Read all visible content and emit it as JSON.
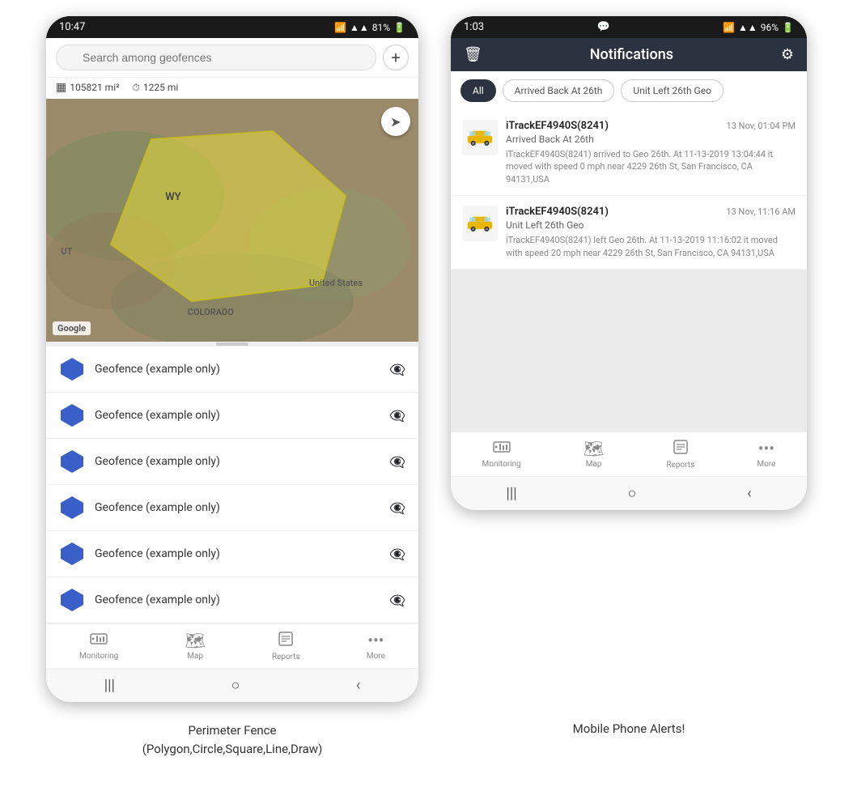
{
  "left_phone": {
    "status_bar": {
      "time": "10:47",
      "signal": "WiFi",
      "bars": "▲▲▲",
      "battery": "81%"
    },
    "search": {
      "placeholder": "Search among geofences"
    },
    "stats": {
      "area": "105821 mi²",
      "distance": "1225 mi"
    },
    "map_labels": {
      "wy": "WY",
      "us": "United States",
      "colorado": "COLORADO",
      "ut": "UT"
    },
    "geofence_items": [
      {
        "label": "Geofence (example only)"
      },
      {
        "label": "Geofence (example only)"
      },
      {
        "label": "Geofence (example only)"
      },
      {
        "label": "Geofence (example only)"
      },
      {
        "label": "Geofence (example only)"
      },
      {
        "label": "Geofence (example only)"
      }
    ],
    "bottom_nav": [
      {
        "label": "Monitoring",
        "icon": "🚌"
      },
      {
        "label": "Map",
        "icon": "🗺"
      },
      {
        "label": "Reports",
        "icon": "📊"
      },
      {
        "label": "More",
        "icon": "···"
      }
    ]
  },
  "right_phone": {
    "status_bar": {
      "time": "1:03",
      "chat_icon": "💬",
      "signal": "WiFi",
      "bars": "▲▲▲",
      "battery": "96%"
    },
    "header": {
      "title": "Notifications",
      "delete_icon": "🗑",
      "settings_icon": "⚙"
    },
    "filter_tabs": [
      {
        "label": "All",
        "active": true
      },
      {
        "label": "Arrived Back At 26th",
        "active": false
      },
      {
        "label": "Unit Left 26th Geo",
        "active": false
      }
    ],
    "notifications": [
      {
        "device": "iTrackEF4940S(8241)",
        "time": "13 Nov, 01:04 PM",
        "event": "Arrived Back At 26th",
        "body": "iTrackEF4940S(8241) arrived to Geo 26th.   At 11-13-2019 13:04:44 it moved with speed 0 mph near 4229 26th St, San Francisco, CA 94131,USA"
      },
      {
        "device": "iTrackEF4940S(8241)",
        "time": "13 Nov, 11:16 AM",
        "event": "Unit Left 26th Geo",
        "body": "iTrackEF4940S(8241) left Geo 26th.   At 11-13-2019 11:16:02 it moved with speed 20 mph near 4229 26th St, San Francisco, CA 94131,USA"
      }
    ],
    "bottom_nav": [
      {
        "label": "Monitoring",
        "icon": "🚌"
      },
      {
        "label": "Map",
        "icon": "🗺"
      },
      {
        "label": "Reports",
        "icon": "📊"
      },
      {
        "label": "More",
        "icon": "···"
      }
    ]
  },
  "captions": {
    "left": "Perimeter Fence\n(Polygon,Circle,Square,Line,Draw)",
    "right": "Mobile Phone Alerts!"
  }
}
